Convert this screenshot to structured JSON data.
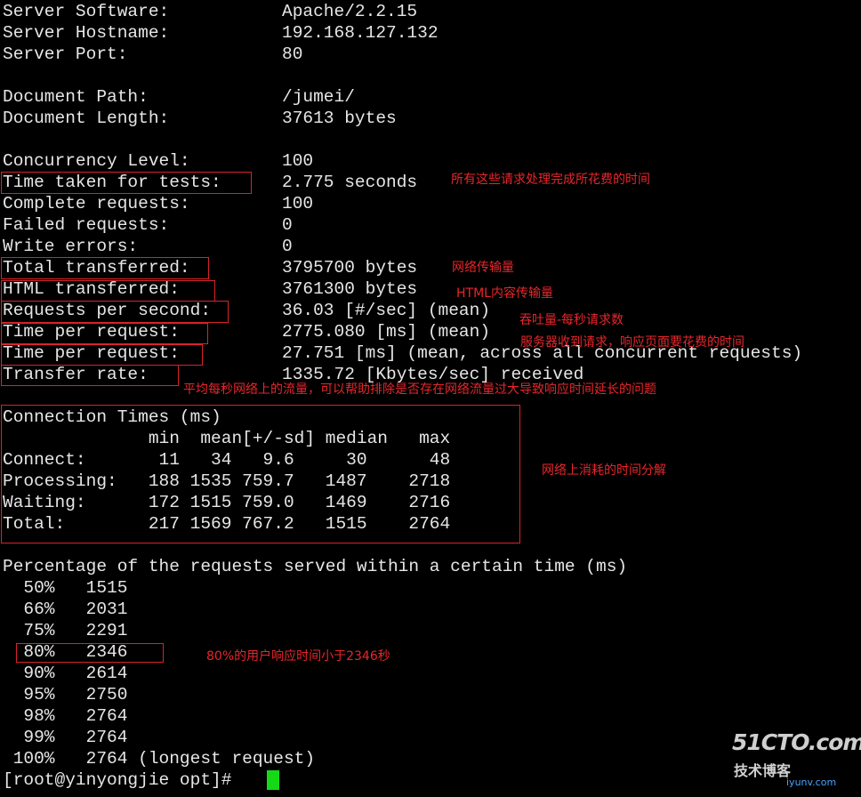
{
  "server_info": [
    {
      "label": "Server Software:",
      "value": "Apache/2.2.15"
    },
    {
      "label": "Server Hostname:",
      "value": "192.168.127.132"
    },
    {
      "label": "Server Port:",
      "value": "80"
    }
  ],
  "document_info": [
    {
      "label": "Document Path:",
      "value": "/jumei/"
    },
    {
      "label": "Document Length:",
      "value": "37613 bytes"
    }
  ],
  "test_stats": [
    {
      "label": "Concurrency Level:",
      "value": "100"
    },
    {
      "label": "Time taken for tests:",
      "value": "2.775 seconds"
    },
    {
      "label": "Complete requests:",
      "value": "100"
    },
    {
      "label": "Failed requests:",
      "value": "0"
    },
    {
      "label": "Write errors:",
      "value": "0"
    },
    {
      "label": "Total transferred:",
      "value": "3795700 bytes"
    },
    {
      "label": "HTML transferred:",
      "value": "3761300 bytes"
    },
    {
      "label": "Requests per second:",
      "value": "36.03 [#/sec] (mean)"
    },
    {
      "label": "Time per request:",
      "value": "2775.080 [ms] (mean)"
    },
    {
      "label": "Time per request:",
      "value": "27.751 [ms] (mean, across all concurrent requests)"
    },
    {
      "label": "Transfer rate:",
      "value": "1335.72 [Kbytes/sec] received"
    }
  ],
  "connection_times": {
    "title": "Connection Times (ms)",
    "header": "              min  mean[+/-sd] median   max",
    "rows": [
      "Connect:       11   34   9.6     30      48",
      "Processing:   188 1535 759.7   1487    2718",
      "Waiting:      172 1515 759.0   1469    2716",
      "Total:        217 1569 767.2   1515    2764"
    ]
  },
  "percentiles": {
    "title": "Percentage of the requests served within a certain time (ms)",
    "rows": [
      "  50%   1515",
      "  66%   2031",
      "  75%   2291",
      "  80%   2346",
      "  90%   2614",
      "  95%   2750",
      "  98%   2764",
      "  99%   2764",
      " 100%   2764 (longest request)"
    ]
  },
  "prompt": "[root@yinyongjie opt]# ",
  "annotations": {
    "time_taken": "所有这些请求处理完成所花费的时间",
    "total_transferred": "网络传输量",
    "html_transferred": "HTML内容传输量",
    "requests_per_second": "吞吐量-每秒请求数",
    "time_per_request": "服务器收到请求，响应页面要花费的时间",
    "transfer_rate": "平均每秒网络上的流量，可以帮助排除是否存在网络流量过大导致响应时间延长的问题",
    "connection_times": "网络上消耗的时间分解",
    "percentile_80": "80%的用户响应时间小于2346秒"
  },
  "watermark": {
    "brand": "51CTO.com",
    "sub": "技术博客",
    "url": "iyunv.com"
  },
  "colors": {
    "background": "#000000",
    "text": "#e6e6e6",
    "annotation": "#e8262b",
    "cursor": "#16d916"
  }
}
